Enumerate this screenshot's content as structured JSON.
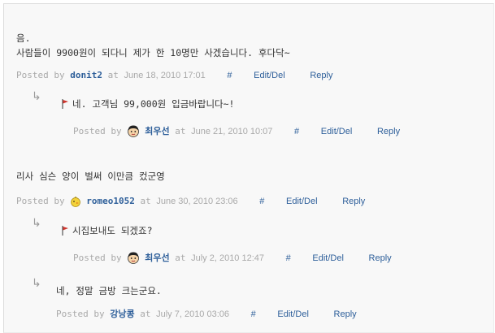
{
  "comments": [
    {
      "text_lines": [
        "음.",
        "사람들이 9900원이 되다니 제가 한 10명만 사겠습니다. 후다닥~"
      ],
      "posted_by": "Posted by",
      "author": "donit2",
      "at": "at",
      "date": "June 18, 2010 17:01",
      "permalink": "#",
      "edit": "Edit/Del",
      "reply": "Reply",
      "replies": [
        {
          "arrow": "↳",
          "text": "네. 고객님 99,000원 입금바랍니다~!",
          "posted_by": "Posted by",
          "author": "최우선",
          "at": "at",
          "date": "June 21, 2010 10:07",
          "permalink": "#",
          "edit": "Edit/Del",
          "reply": "Reply"
        }
      ]
    },
    {
      "text_lines": [
        "리사 심슨 양이 벌써 이만큼 컸군영"
      ],
      "posted_by": "Posted by",
      "author": "romeo1052",
      "at": "at",
      "date": "June 30, 2010 23:06",
      "permalink": "#",
      "edit": "Edit/Del",
      "reply": "Reply",
      "replies": [
        {
          "arrow": "↳",
          "text": "시집보내도 되겠죠?",
          "posted_by": "Posted by",
          "author": "최우선",
          "at": "at",
          "date": "July 2, 2010 12:47",
          "permalink": "#",
          "edit": "Edit/Del",
          "reply": "Reply"
        },
        {
          "arrow": "↳",
          "text": "네, 정말 금방 크는군요.",
          "posted_by": "Posted by",
          "author": "강낭콩",
          "at": "at",
          "date": "July 7, 2010 03:06",
          "permalink": "#",
          "edit": "Edit/Del",
          "reply": "Reply"
        }
      ]
    }
  ],
  "colors": {
    "link": "#2e5f9a",
    "meta": "#a9a9a9",
    "text": "#333333",
    "background": "#f8f8f8",
    "flag": "#d0342c"
  },
  "icons": {
    "reply_marker": "red-flag-icon",
    "admin_avatar": "face-avatar-icon",
    "user_avatar": "chick-avatar-icon"
  }
}
